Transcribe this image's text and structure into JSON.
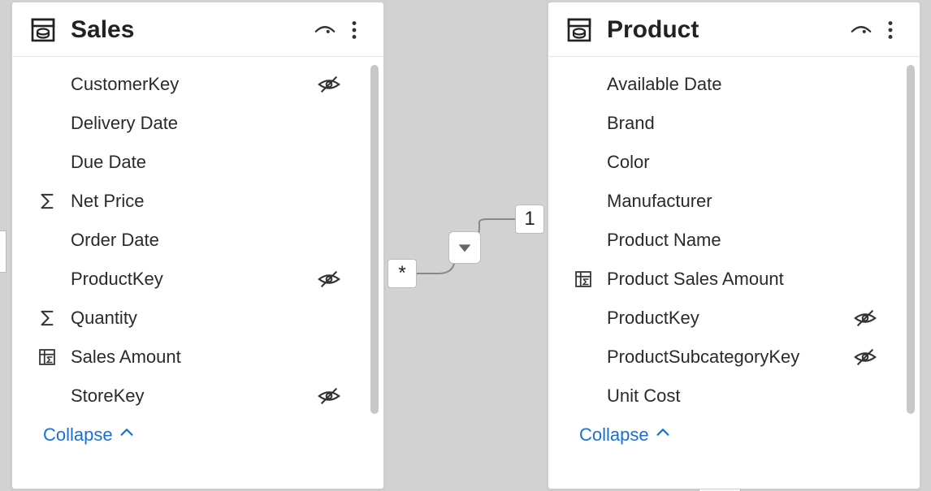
{
  "collapse_label": "Collapse",
  "relationship": {
    "many_symbol": "*",
    "one_symbol": "1"
  },
  "tables": {
    "sales": {
      "title": "Sales",
      "fields": [
        {
          "name": "CustomerKey",
          "icon": "none",
          "hidden": true
        },
        {
          "name": "Delivery Date",
          "icon": "none",
          "hidden": false
        },
        {
          "name": "Due Date",
          "icon": "none",
          "hidden": false
        },
        {
          "name": "Net Price",
          "icon": "sigma",
          "hidden": false
        },
        {
          "name": "Order Date",
          "icon": "none",
          "hidden": false
        },
        {
          "name": "ProductKey",
          "icon": "none",
          "hidden": true
        },
        {
          "name": "Quantity",
          "icon": "sigma",
          "hidden": false
        },
        {
          "name": "Sales Amount",
          "icon": "measure",
          "hidden": false
        },
        {
          "name": "StoreKey",
          "icon": "none",
          "hidden": true
        }
      ]
    },
    "product": {
      "title": "Product",
      "fields": [
        {
          "name": "Available Date",
          "icon": "none",
          "hidden": false
        },
        {
          "name": "Brand",
          "icon": "none",
          "hidden": false
        },
        {
          "name": "Color",
          "icon": "none",
          "hidden": false
        },
        {
          "name": "Manufacturer",
          "icon": "none",
          "hidden": false
        },
        {
          "name": "Product Name",
          "icon": "none",
          "hidden": false
        },
        {
          "name": "Product Sales Amount",
          "icon": "measure",
          "hidden": false
        },
        {
          "name": "ProductKey",
          "icon": "none",
          "hidden": true
        },
        {
          "name": "ProductSubcategoryKey",
          "icon": "none",
          "hidden": true
        },
        {
          "name": "Unit Cost",
          "icon": "none",
          "hidden": false
        }
      ]
    }
  }
}
